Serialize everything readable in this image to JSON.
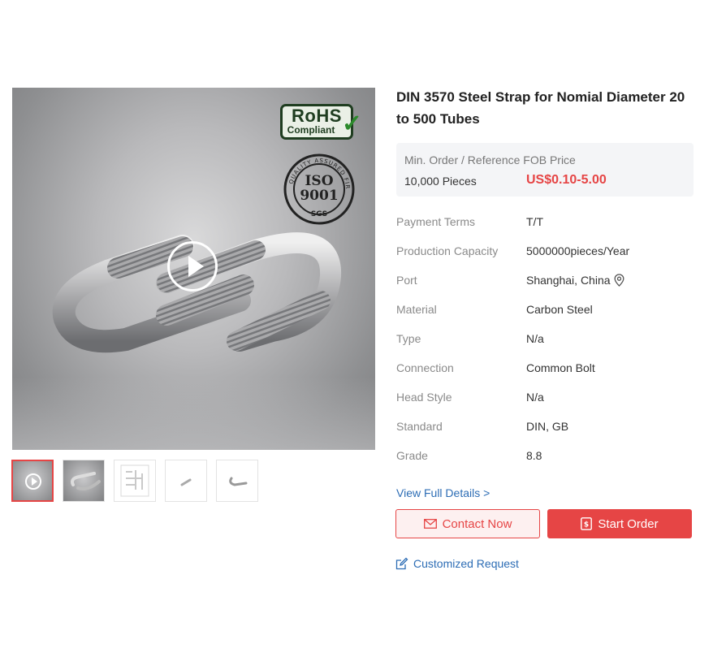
{
  "product": {
    "title": "DIN 3570 Steel Strap for Nomial Diameter 20 to 500 Tubes"
  },
  "gallery": {
    "badges": {
      "rohs_line1": "RoHS",
      "rohs_line2": "Compliant",
      "iso_line1": "ISO",
      "iso_line2": "9001",
      "iso_ring": "QUALITY ASSURED FIRM",
      "iso_mark": "SGS"
    },
    "thumbnail_count": 5
  },
  "price": {
    "label": "Min. Order / Reference FOB Price",
    "min_order": "10,000 Pieces",
    "range": "US$0.10-5.00"
  },
  "specs": [
    {
      "key": "Payment Terms",
      "value": "T/T"
    },
    {
      "key": "Production Capacity",
      "value": "5000000pieces/Year"
    },
    {
      "key": "Port",
      "value": "Shanghai, China"
    },
    {
      "key": "Material",
      "value": "Carbon Steel"
    },
    {
      "key": "Type",
      "value": "N/a"
    },
    {
      "key": "Connection",
      "value": "Common Bolt"
    },
    {
      "key": "Head Style",
      "value": "N/a"
    },
    {
      "key": "Standard",
      "value": "DIN, GB"
    },
    {
      "key": "Grade",
      "value": "8.8"
    }
  ],
  "actions": {
    "view_details": "View Full Details >",
    "contact": "Contact Now",
    "start_order": "Start Order",
    "customized": "Customized Request"
  },
  "colors": {
    "accent": "#e64545",
    "link": "#2d6db5"
  },
  "icons": [
    "play-icon",
    "location-pin-icon",
    "mail-icon",
    "order-icon",
    "edit-icon"
  ]
}
